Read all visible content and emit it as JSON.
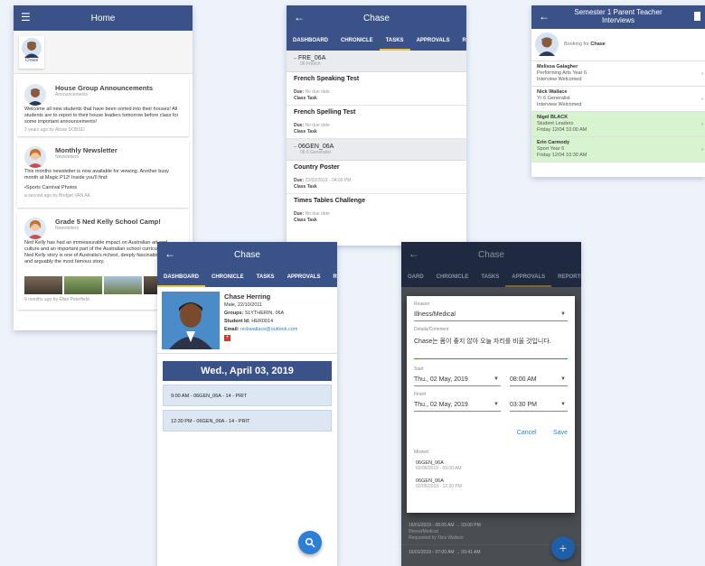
{
  "home": {
    "title": "Home",
    "profile_name": "Chase",
    "posts": [
      {
        "title": "House Group Announcements",
        "subtitle": "Announcements",
        "body": "Welcome all new students that have been sorted into their houses! All students are to report to their house leaders tomorrow before class for some important announcements!",
        "meta": "2 years ago by Alisse DOBSO"
      },
      {
        "title": "Monthly Newsletter",
        "subtitle": "Newsletters",
        "body": "This months newsletter is now available for viewing. Another busy month at Magic P12! Inside you'll find:",
        "body2": "•Sports Carnival Photos",
        "meta": "a second ago by Bridget VAN AK"
      },
      {
        "title": "Grade 5 Ned Kelly School Camp!",
        "subtitle": "Newsletters",
        "body": "Ned Kelly has had an immeasurable impact on Australian art and culture and an important part of the Australian school curriculum. The Ned Kelly story is one of Australia's richest, deeply fascinating tales and arguably the most famous story.",
        "meta": "9 months ago by Elise Peterfield"
      }
    ]
  },
  "tasks_screen": {
    "title": "Chase",
    "tabs": [
      "DASHBOARD",
      "CHRONICLE",
      "TASKS",
      "APPROVALS",
      "REPO"
    ],
    "active_tab": "TASKS",
    "groups": [
      {
        "code": "FRE_06A",
        "name": "06 French",
        "tasks": [
          {
            "title": "French Speaking Test",
            "due_label": "Due:",
            "due": "No due date",
            "type": "Class Task"
          },
          {
            "title": "French Spelling Test",
            "due_label": "Due:",
            "due": "No due date",
            "type": "Class Task"
          }
        ]
      },
      {
        "code": "06GEN_06A",
        "name": "06 6 Generalist",
        "tasks": [
          {
            "title": "Country Poster",
            "due_label": "Due:",
            "due": "22/02/2019 - 04:00 PM",
            "type": "Class Task"
          },
          {
            "title": "Times Tables Challenge",
            "due_label": "Due:",
            "due": "No due date",
            "type": "Class Task"
          }
        ]
      }
    ]
  },
  "pt_screen": {
    "title_line1": "Semester 1 Parent Teacher",
    "title_line2": "Interviews",
    "booking_label": "Booking for",
    "booking_name": "Chase",
    "teachers": [
      {
        "name": "Melissa Galagher",
        "line1": "Performing Arts Year 6",
        "line2": "Interview Welcomed",
        "booked": false
      },
      {
        "name": "Nick Wallace",
        "line1": "Yr 6 Generalist",
        "line2": "Interview Welcomed",
        "booked": false
      },
      {
        "name": "Nigel BLACK",
        "line1": "Student Leaders",
        "line2": "Friday 12/04 10:00 AM",
        "booked": true
      },
      {
        "name": "Erin Carmody",
        "line1": "Sport Year 6",
        "line2": "Friday 12/04 10:30 AM",
        "booked": true
      }
    ],
    "colors": {
      "booked": "#d8f3d0"
    }
  },
  "dashboard": {
    "title": "Chase",
    "tabs": [
      "DASHBOARD",
      "CHRONICLE",
      "TASKS",
      "APPROVALS",
      "REP"
    ],
    "active_tab": "DASHBOARD",
    "student": {
      "name": "Chase Herring",
      "gender_dob": "Male, 22/10/2011",
      "groups_label": "Groups:",
      "groups": "SLYTHERIN, 06A",
      "id_label": "Student Id:",
      "id": "HER0014",
      "email_label": "Email:",
      "email": "nickwallace@outlook.com"
    },
    "date_banner": "Wed., April 03, 2019",
    "schedule": [
      "9:00 AM - 06GEN_06A - 14 - PRIT",
      "12:30 PM - 06GEN_06A - 14 - PRIT"
    ]
  },
  "approvals": {
    "title": "Chase",
    "tabs": [
      "OARD",
      "CHRONICLE",
      "TASKS",
      "APPROVALS",
      "REPORTS"
    ],
    "active_tab": "APPROVALS",
    "background_rows": [
      {
        "line1": "16/01/2019 - 08:00 AM  →  03:00 PM",
        "line2": "Illness/Medical",
        "line3": "Requested by Nick Wallace"
      },
      {
        "line1": "16/01/2019 - 07:00 AM  →  09:41 AM",
        "line2": "",
        "line3": ""
      }
    ],
    "dialog": {
      "reason_label": "Reason",
      "reason_value": "Illness/Medical",
      "details_label": "Details/Comment",
      "details_value": "Chase는 몸이 좋지 않아 오늘 자리를 비울 것입니다.",
      "start_label": "Start",
      "start_date": "Thu., 02 May, 2019",
      "start_time": "08:00 AM",
      "finish_label": "Finish",
      "finish_date": "Thu., 02 May, 2019",
      "finish_time": "03:30 PM",
      "cancel": "Cancel",
      "save": "Save",
      "missed_label": "Missed",
      "missed": [
        {
          "code": "06GEN_06A",
          "time": "02/05/2019 - 09:00 AM"
        },
        {
          "code": "06GEN_06A",
          "time": "02/05/2019 - 12:30 PM"
        }
      ]
    }
  },
  "colors": {
    "app_bar": "#3b5289",
    "accent": "#2d7fd6",
    "background": "#eef3fa"
  }
}
